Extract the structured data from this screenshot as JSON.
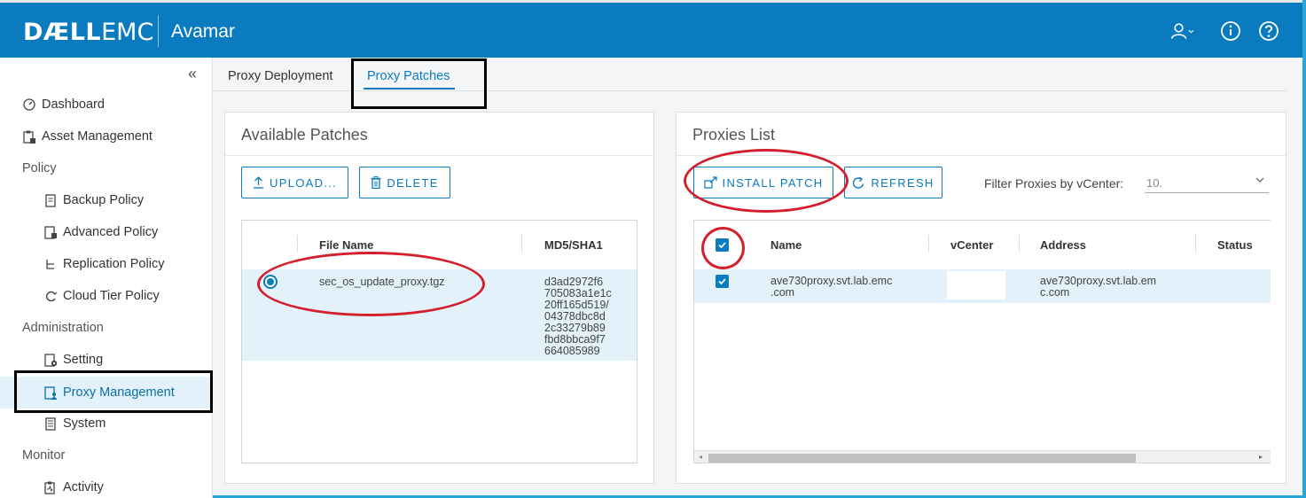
{
  "header": {
    "logo_dell": "DÆLL",
    "logo_emc": "EMC",
    "app_name": "Avamar",
    "icons": [
      "user-icon",
      "info-icon",
      "help-icon"
    ]
  },
  "sidebar": {
    "collapse_glyph": "«",
    "items": {
      "dashboard": "Dashboard",
      "asset_management": "Asset Management",
      "policy": "Policy",
      "backup_policy": "Backup Policy",
      "advanced_policy": "Advanced Policy",
      "replication_policy": "Replication Policy",
      "cloud_tier_policy": "Cloud Tier Policy",
      "administration": "Administration",
      "setting": "Setting",
      "proxy_management": "Proxy Management",
      "system": "System",
      "monitor": "Monitor",
      "activity": "Activity"
    }
  },
  "tabs": [
    {
      "label": "Proxy Deployment"
    },
    {
      "label": "Proxy Patches",
      "active": true
    }
  ],
  "patches": {
    "title": "Available Patches",
    "upload_label": "UPLOAD...",
    "delete_label": "DELETE",
    "columns": [
      "File Name",
      "MD5/SHA1"
    ],
    "rows": [
      {
        "selected": true,
        "file_name": "sec_os_update_proxy.tgz",
        "md5_lines": [
          "d3ad2972f6",
          "705083a1e1c",
          "20ff165d519/",
          "04378dbc8d",
          "2c33279b89",
          "fbd8bbca9f7",
          "664085989"
        ]
      }
    ]
  },
  "proxies": {
    "title": "Proxies List",
    "install_label": "INSTALL PATCH",
    "refresh_label": "REFRESH",
    "filter_label": "Filter Proxies by vCenter:",
    "filter_value": "10.",
    "columns": [
      "Name",
      "vCenter",
      "Address",
      "Status"
    ],
    "rows": [
      {
        "checked": true,
        "name_lines": [
          "ave730proxy.svt.lab.emc",
          ".com"
        ],
        "vcenter": "",
        "address_lines": [
          "ave730proxy.svt.lab.em",
          "c.com"
        ],
        "status": ""
      }
    ]
  },
  "colors": {
    "brand": "#0b7bbf",
    "row_selected": "#e3f1fb",
    "annotation_red": "#d4202c",
    "annotation_black": "#000000"
  }
}
